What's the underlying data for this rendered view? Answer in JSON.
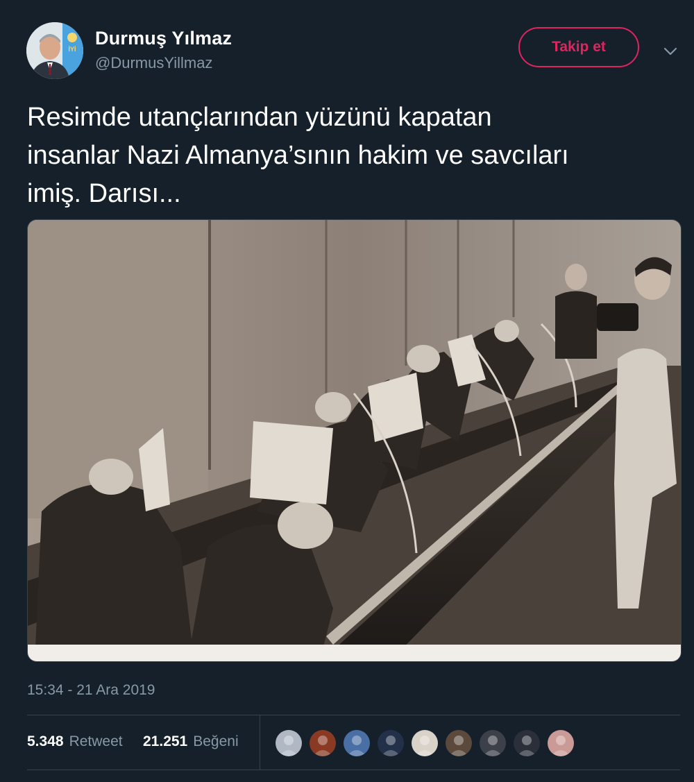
{
  "user": {
    "display_name": "Durmuş Yılmaz",
    "handle": "@DurmusYillmaz",
    "avatar_icon": "profile-photo",
    "party_logo_text": "İYİ"
  },
  "follow_button": {
    "label": "Takip et"
  },
  "menu_icon": "chevron-down-icon",
  "tweet": {
    "text": "Resimde utançlarından yüzünü kapatan\ninsanlar Nazi Almanya’sının hakim ve savcıları\nimiş. Darısı...",
    "media_description_icon": "courtroom-photo",
    "timestamp": "15:34 - 21 Ara 2019"
  },
  "stats": {
    "retweets": {
      "count": "5.348",
      "label": "Retweet"
    },
    "likes": {
      "count": "21.251",
      "label": "Beğeni"
    }
  },
  "likers": [
    {
      "name": "liker-avatar-1",
      "color": "#b0b8c4"
    },
    {
      "name": "liker-avatar-2",
      "color": "#8a3a22"
    },
    {
      "name": "liker-avatar-3",
      "color": "#4a6fa5"
    },
    {
      "name": "liker-avatar-4",
      "color": "#23304a"
    },
    {
      "name": "liker-avatar-5",
      "color": "#d9d2c8"
    },
    {
      "name": "liker-avatar-6",
      "color": "#5b4a3c"
    },
    {
      "name": "liker-avatar-7",
      "color": "#3c4048"
    },
    {
      "name": "liker-avatar-8",
      "color": "#2a2f3a"
    },
    {
      "name": "liker-avatar-9",
      "color": "#c99a96"
    }
  ],
  "colors": {
    "background": "#15202b",
    "secondary_text": "#8899a6",
    "follow_accent": "#e0245e",
    "divider": "#38444d"
  }
}
